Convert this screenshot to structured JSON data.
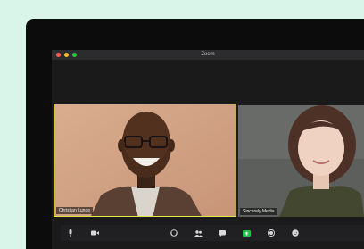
{
  "window": {
    "title": "Zoom"
  },
  "participants": [
    {
      "name": "Christian Lunde",
      "active_speaker": true
    },
    {
      "name": "Sincerely Media",
      "active_speaker": false
    }
  ],
  "toolbar": {
    "buttons": [
      "mute-icon",
      "video-icon",
      "security-icon",
      "participants-icon",
      "chat-icon",
      "share-screen-icon",
      "record-icon",
      "reactions-icon"
    ]
  },
  "colors": {
    "active_speaker_border": "#e3e84a",
    "share_green": "#1fbf4a",
    "background": "#d9f5ea"
  }
}
